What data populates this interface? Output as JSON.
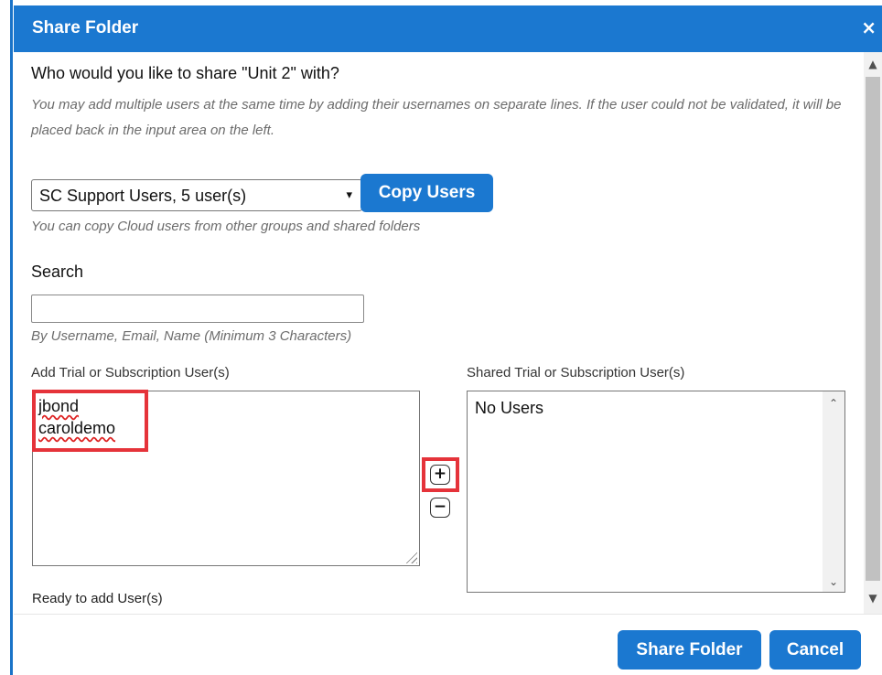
{
  "dialog": {
    "title": "Share Folder",
    "close_icon": "×"
  },
  "main": {
    "question": "Who would you like to share \"Unit 2\" with?",
    "help_text": "You may add multiple users at the same time by adding their usernames on separate lines. If the user could not be validated, it will be placed back in the input area on the left.",
    "group_select": {
      "value": "SC Support Users, 5 user(s)"
    },
    "copy_button": "Copy Users",
    "copy_help": "You can copy Cloud users from other groups and shared folders",
    "search_label": "Search",
    "search_value": "",
    "search_help": "By Username, Email, Name (Minimum 3 Characters)",
    "add_label": "Add Trial or Subscription User(s)",
    "shared_label": "Shared Trial or Subscription User(s)",
    "add_users": [
      "jbond",
      "caroldemo"
    ],
    "shared_empty": "No Users",
    "status": "Ready to add User(s)"
  },
  "footer": {
    "share_button": "Share Folder",
    "cancel_button": "Cancel"
  },
  "colors": {
    "accent": "#1b78d0",
    "highlight": "#e5333a"
  }
}
